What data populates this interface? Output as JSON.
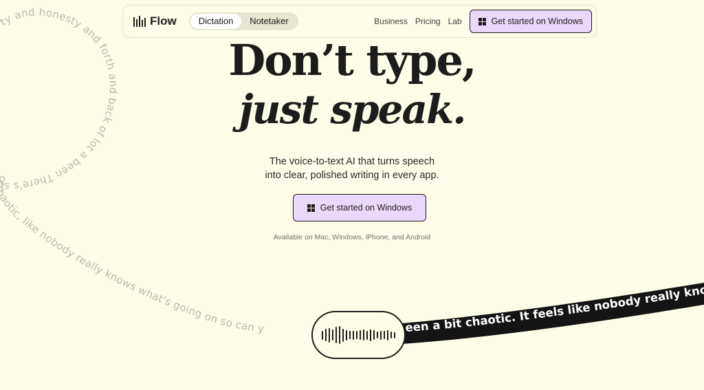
{
  "nav": {
    "logo_text": "Flow",
    "tabs": [
      {
        "label": "Dictation",
        "active": true
      },
      {
        "label": "Notetaker",
        "active": false
      }
    ],
    "links": [
      "Business",
      "Pricing",
      "Lab"
    ],
    "cta_label": "Get started on Windows"
  },
  "hero": {
    "headline_line1": "Don’t type,",
    "headline_line2": "just speak.",
    "subtitle_line1": "The voice-to-text AI that turns speech",
    "subtitle_line2": "into clear, polished writing in every app.",
    "cta_label": "Get started on Windows",
    "availability": "Available on Mac, Windows, iPhone, and Android"
  },
  "decor": {
    "curved_text": "ty and honesty and forth and back of lot a been There's slip. of chaotic, like nobody really knows what's going on so can y",
    "band_text": "een a bit chaotic. It feels like nobody really knows",
    "waveform_levels": [
      0.3,
      0.55,
      0.7,
      0.45,
      0.8,
      0.9,
      0.6,
      0.4,
      0.25,
      0.3,
      0.25,
      0.35,
      0.45,
      0.3,
      0.5,
      0.35,
      0.2,
      0.3,
      0.25,
      0.4,
      0.2,
      0.15
    ]
  },
  "colors": {
    "background": "#fdfde9",
    "cta_fill": "#ead8fb",
    "ink": "#1c1c1c"
  }
}
